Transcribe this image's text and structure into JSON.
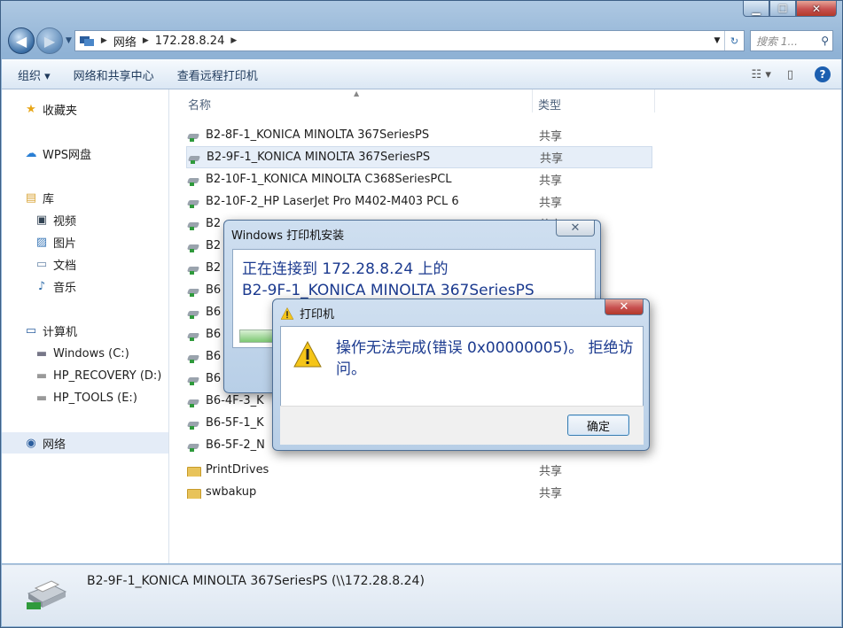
{
  "explorer": {
    "address": {
      "root": "网络",
      "host": "172.28.8.24"
    },
    "search_placeholder": "搜索 1...",
    "toolbar": {
      "organize": "组织 ▾",
      "network_center": "网络和共享中心",
      "view_printers": "查看远程打印机"
    },
    "nav": {
      "favorites": "收藏夹",
      "wps": "WPS网盘",
      "library": "库",
      "videos": "视频",
      "pictures": "图片",
      "documents": "文档",
      "music": "音乐",
      "computer": "计算机",
      "drive_c": "Windows (C:)",
      "drive_d": "HP_RECOVERY (D:)",
      "drive_e": "HP_TOOLS (E:)",
      "network": "网络"
    },
    "columns": {
      "name": "名称",
      "type": "类型"
    },
    "items": [
      {
        "name": "B2-8F-1_KONICA MINOLTA 367SeriesPS",
        "type": "共享",
        "kind": "printer"
      },
      {
        "name": "B2-9F-1_KONICA MINOLTA 367SeriesPS",
        "type": "共享",
        "kind": "printer"
      },
      {
        "name": "B2-10F-1_KONICA MINOLTA C368SeriesPCL",
        "type": "共享",
        "kind": "printer"
      },
      {
        "name": "B2-10F-2_HP LaserJet Pro M402-M403 PCL 6",
        "type": "共享",
        "kind": "printer"
      },
      {
        "name": "B2",
        "type": "共享",
        "kind": "printer"
      },
      {
        "name": "B2",
        "type": "",
        "kind": "printer"
      },
      {
        "name": "B2",
        "type": "",
        "kind": "printer"
      },
      {
        "name": "B6",
        "type": "",
        "kind": "printer"
      },
      {
        "name": "B6",
        "type": "",
        "kind": "printer"
      },
      {
        "name": "B6",
        "type": "",
        "kind": "printer"
      },
      {
        "name": "B6",
        "type": "",
        "kind": "printer"
      },
      {
        "name": "B6",
        "type": "",
        "kind": "printer"
      },
      {
        "name": "B6-4F-3_K",
        "type": "",
        "kind": "printer"
      },
      {
        "name": "B6-5F-1_K",
        "type": "",
        "kind": "printer"
      },
      {
        "name": "B6-5F-2_N",
        "type": "",
        "kind": "printer"
      },
      {
        "name": "PrintDrives",
        "type": "共享",
        "kind": "folder"
      },
      {
        "name": "swbakup",
        "type": "共享",
        "kind": "folder"
      }
    ],
    "status": "B2-9F-1_KONICA MINOLTA 367SeriesPS (\\\\172.28.8.24)"
  },
  "install_dialog": {
    "title": "Windows 打印机安装",
    "line1": "正在连接到 172.28.8.24 上的",
    "line2": "B2-9F-1_KONICA MINOLTA 367SeriesPS"
  },
  "error_dialog": {
    "title": "打印机",
    "message": "操作无法完成(错误 0x00000005)。 拒绝访问。",
    "ok": "确定"
  }
}
